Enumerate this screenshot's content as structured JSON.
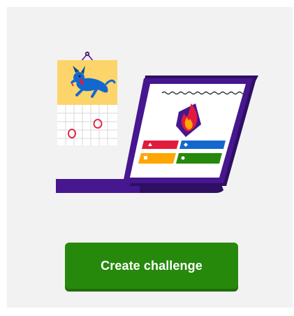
{
  "illustration": {
    "icons": [
      "calendar-icon",
      "dog-icon",
      "laptop-icon",
      "flame-badge-icon",
      "answer-triangle-icon",
      "answer-diamond-icon",
      "answer-circle-icon",
      "answer-square-icon"
    ],
    "colors": {
      "laptop_purple": "#46178f",
      "answer_red": "#e21b3c",
      "answer_blue": "#1368ce",
      "answer_yellow": "#ffa602",
      "answer_green": "#26890c",
      "calendar_yellow": "#fcd46a"
    }
  },
  "create_button": {
    "label": "Create challenge",
    "color": "#26890c"
  }
}
